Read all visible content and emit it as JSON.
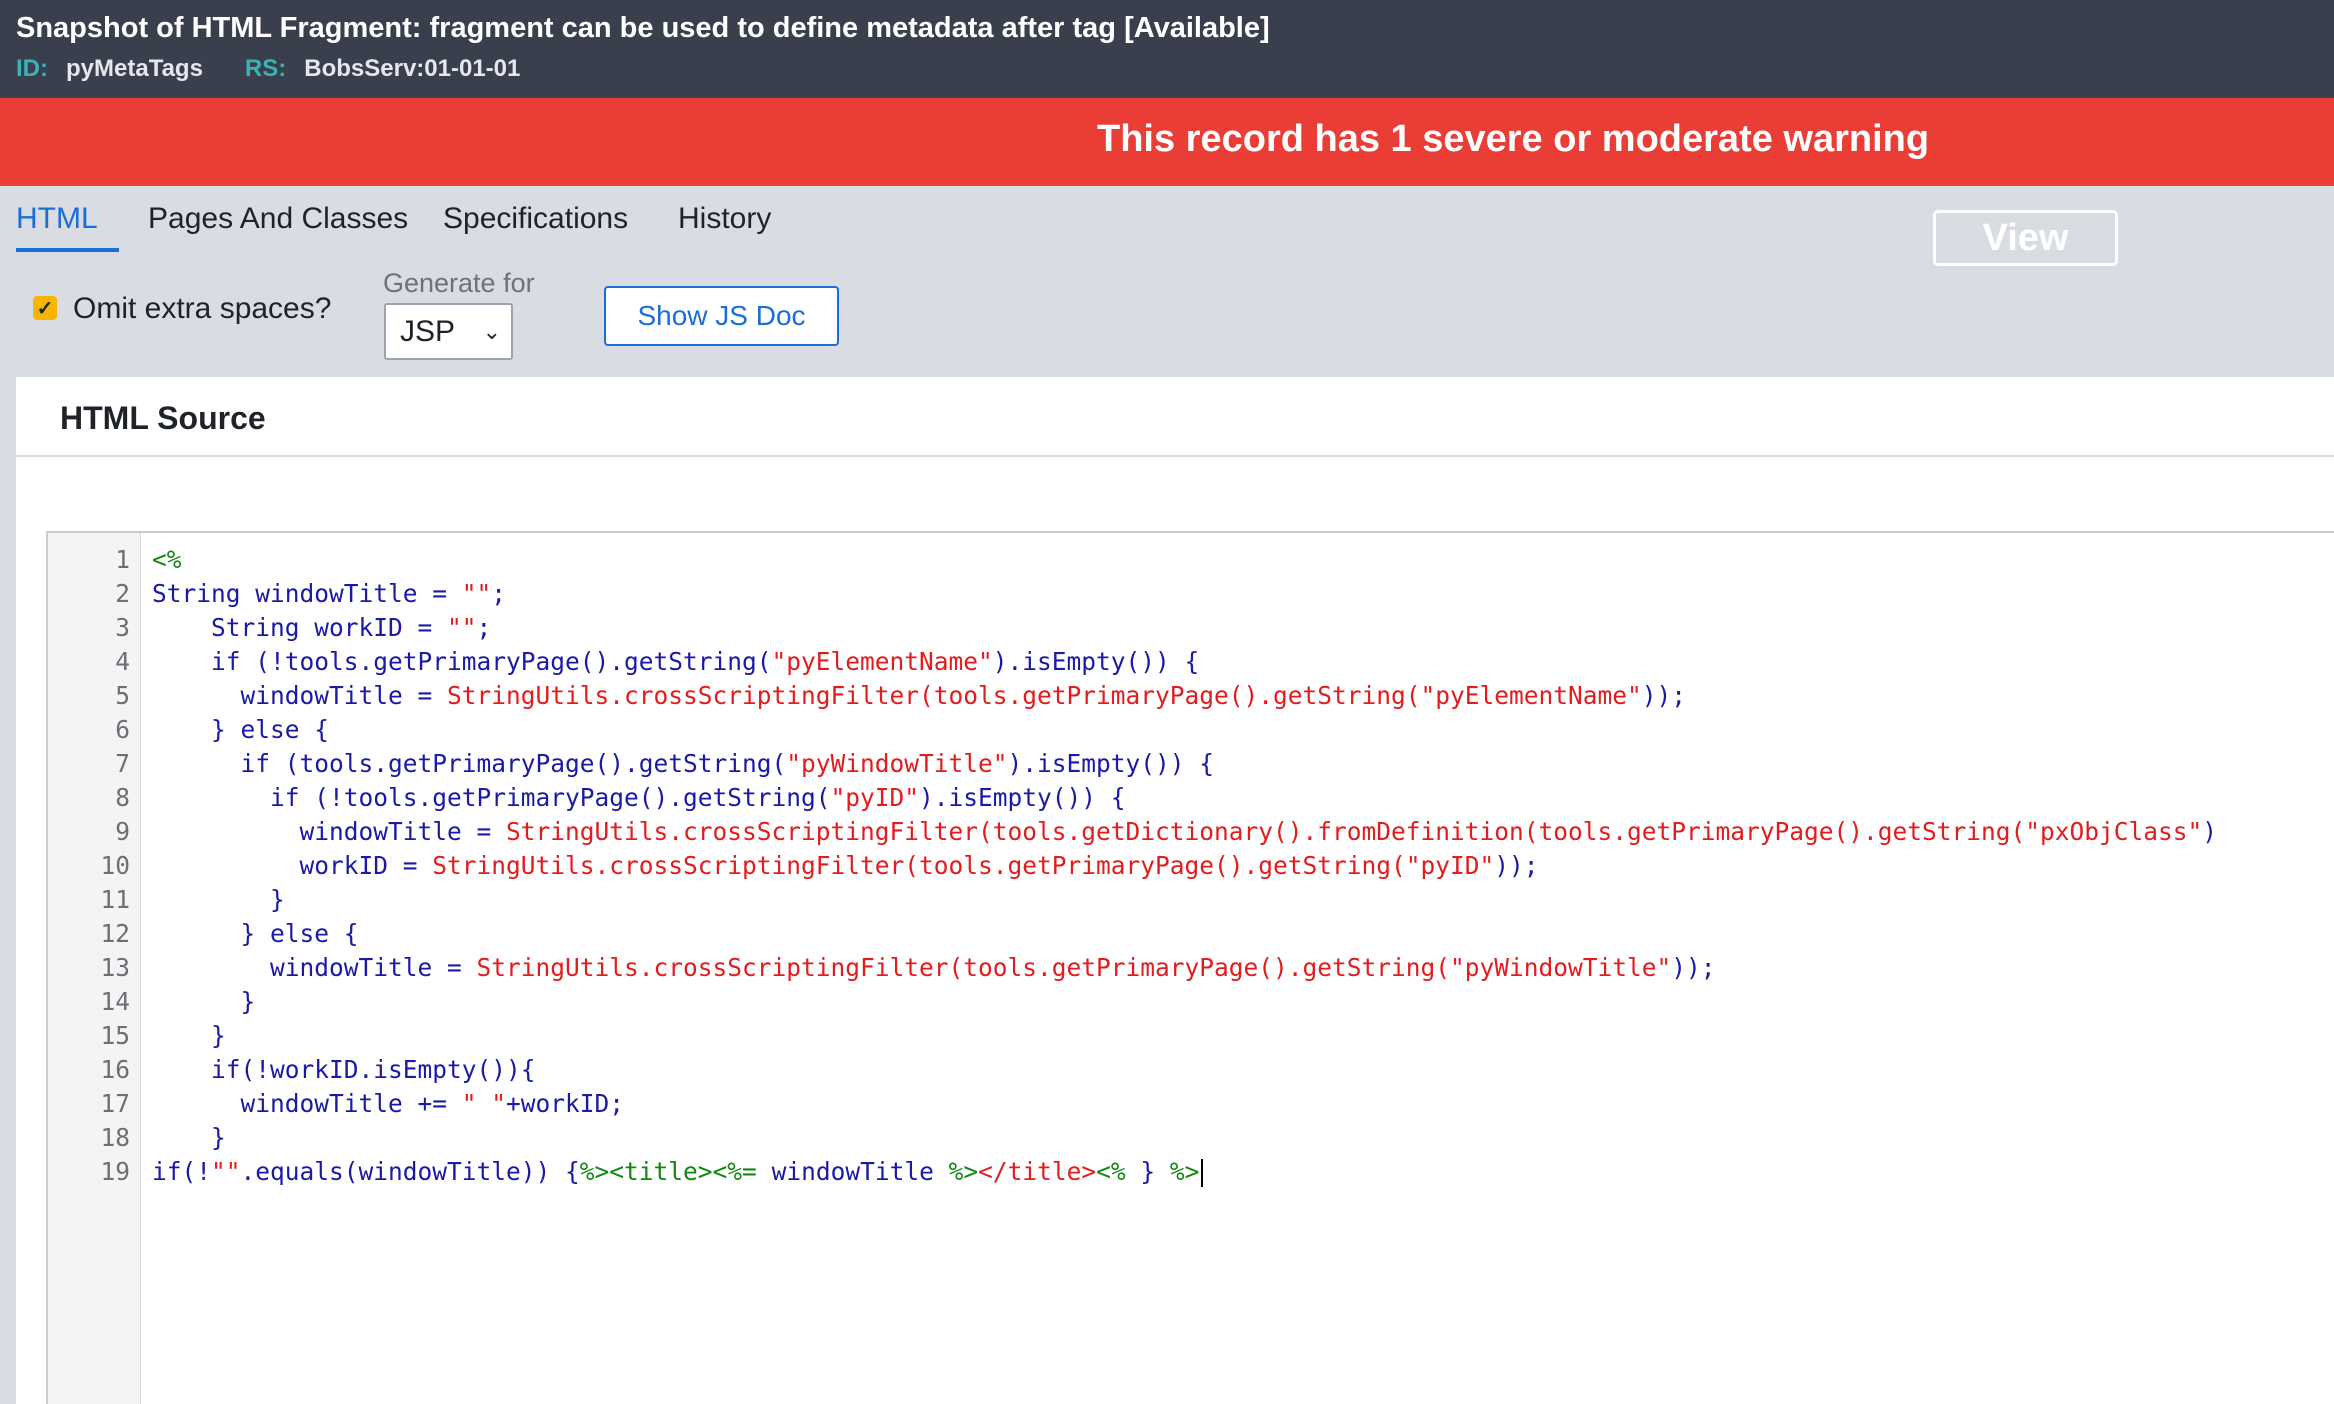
{
  "header": {
    "prefix": "Snapshot of",
    "title": "HTML Fragment: fragment can be used to define metadata after tag",
    "status": "[Available]",
    "id_label": "ID:",
    "id_value": "pyMetaTags",
    "rs_label": "RS:",
    "rs_value": "BobsServ:01-01-01"
  },
  "banner": {
    "message": "This record has 1 severe or moderate warning",
    "view_label": "View",
    "color": "#ea3d35"
  },
  "tabs": [
    {
      "label": "HTML",
      "active": true
    },
    {
      "label": "Pages And Classes",
      "active": false
    },
    {
      "label": "Specifications",
      "active": false
    },
    {
      "label": "History",
      "active": false
    }
  ],
  "controls": {
    "omit_label": "Omit extra spaces?",
    "omit_checked": true,
    "generate_for_label": "Generate for",
    "generate_for_value": "JSP",
    "show_js_doc_label": "Show JS Doc"
  },
  "panel": {
    "title": "HTML Source"
  },
  "code": {
    "line_numbers": [
      "1",
      "2",
      "3",
      "4",
      "5",
      "6",
      "7",
      "8",
      "9",
      "10",
      "11",
      "12",
      "13",
      "14",
      "15",
      "16",
      "17",
      "18",
      "19"
    ],
    "lines": [
      [
        {
          "t": "tag",
          "s": "<%"
        }
      ],
      [
        {
          "t": "kw",
          "s": "String windowTitle = "
        },
        {
          "t": "str",
          "s": "\"\""
        },
        {
          "t": "kw",
          "s": ";"
        }
      ],
      [
        {
          "t": "kw",
          "s": "    String workID = "
        },
        {
          "t": "str",
          "s": "\"\""
        },
        {
          "t": "kw",
          "s": ";"
        }
      ],
      [
        {
          "t": "kw",
          "s": "    if (!tools.getPrimaryPage().getString("
        },
        {
          "t": "str",
          "s": "\"pyElementName\""
        },
        {
          "t": "kw",
          "s": ").isEmpty()) {"
        }
      ],
      [
        {
          "t": "kw",
          "s": "      windowTitle = "
        },
        {
          "t": "str",
          "s": "StringUtils.crossScriptingFilter(tools.getPrimaryPage().getString(\"pyElementName\""
        },
        {
          "t": "kw",
          "s": "));"
        }
      ],
      [
        {
          "t": "kw",
          "s": "    } else {"
        }
      ],
      [
        {
          "t": "kw",
          "s": "      if (tools.getPrimaryPage().getString("
        },
        {
          "t": "str",
          "s": "\"pyWindowTitle\""
        },
        {
          "t": "kw",
          "s": ").isEmpty()) {"
        }
      ],
      [
        {
          "t": "kw",
          "s": "        if (!tools.getPrimaryPage().getString("
        },
        {
          "t": "str",
          "s": "\"pyID\""
        },
        {
          "t": "kw",
          "s": ").isEmpty()) {"
        }
      ],
      [
        {
          "t": "kw",
          "s": "          windowTitle = "
        },
        {
          "t": "str",
          "s": "StringUtils.crossScriptingFilter(tools.getDictionary().fromDefinition(tools.getPrimaryPage().getString(\"pxObjClass\""
        },
        {
          "t": "kw",
          "s": ")"
        }
      ],
      [
        {
          "t": "kw",
          "s": "          workID = "
        },
        {
          "t": "str",
          "s": "StringUtils.crossScriptingFilter(tools.getPrimaryPage().getString(\"pyID\""
        },
        {
          "t": "kw",
          "s": "));"
        }
      ],
      [
        {
          "t": "kw",
          "s": "        }"
        }
      ],
      [
        {
          "t": "kw",
          "s": "      } else {"
        }
      ],
      [
        {
          "t": "kw",
          "s": "        windowTitle = "
        },
        {
          "t": "str",
          "s": "StringUtils.crossScriptingFilter(tools.getPrimaryPage().getString(\"pyWindowTitle\""
        },
        {
          "t": "kw",
          "s": "));"
        }
      ],
      [
        {
          "t": "kw",
          "s": "      }"
        }
      ],
      [
        {
          "t": "kw",
          "s": "    }"
        }
      ],
      [
        {
          "t": "kw",
          "s": "    if(!workID.isEmpty()){"
        }
      ],
      [
        {
          "t": "kw",
          "s": "      windowTitle += "
        },
        {
          "t": "str",
          "s": "\" \""
        },
        {
          "t": "kw",
          "s": "+workID;"
        }
      ],
      [
        {
          "t": "kw",
          "s": "    }"
        }
      ],
      [
        {
          "t": "kw",
          "s": "if(!"
        },
        {
          "t": "str",
          "s": "\"\""
        },
        {
          "t": "kw",
          "s": ".equals(windowTitle)) {"
        },
        {
          "t": "tag",
          "s": "%><title><%="
        },
        {
          "t": "kw",
          "s": " windowTitle "
        },
        {
          "t": "tag",
          "s": "%>"
        },
        {
          "t": "etag",
          "s": "</title>"
        },
        {
          "t": "tag",
          "s": "<%"
        },
        {
          "t": "kw",
          "s": " } "
        },
        {
          "t": "tag",
          "s": "%>"
        }
      ]
    ]
  }
}
